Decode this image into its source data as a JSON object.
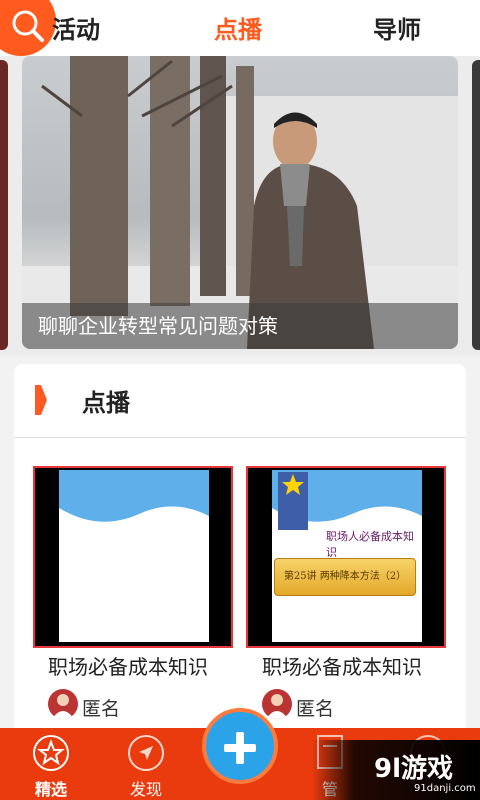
{
  "top_tabs": {
    "activity": "活动",
    "vod": "点播",
    "mentor": "导师",
    "active_color": "#ff5a1f"
  },
  "search": {
    "icon": "search-icon"
  },
  "banner": {
    "caption": "聊聊企业转型常见问题对策"
  },
  "section": {
    "title": "点播",
    "accent": "#ff5a1f"
  },
  "videos": [
    {
      "title": "职场必备成本知识",
      "author": "匿名",
      "slide_text": ""
    },
    {
      "title": "职场必备成本知识",
      "author": "匿名",
      "slide_text": "职场人必备成本知识",
      "slide_badge": "第25讲 两种降本方法（2）"
    }
  ],
  "bottom_nav": {
    "pick": "精选",
    "discover": "发现",
    "manage": "管",
    "add_icon": "plus-icon"
  },
  "watermark": {
    "logo": "9l游戏",
    "url": "91danji.com"
  },
  "colors": {
    "nav_bg": "#e93b0e",
    "plus_bg": "#2aa3e8",
    "thumb_border": "#e8373a"
  }
}
